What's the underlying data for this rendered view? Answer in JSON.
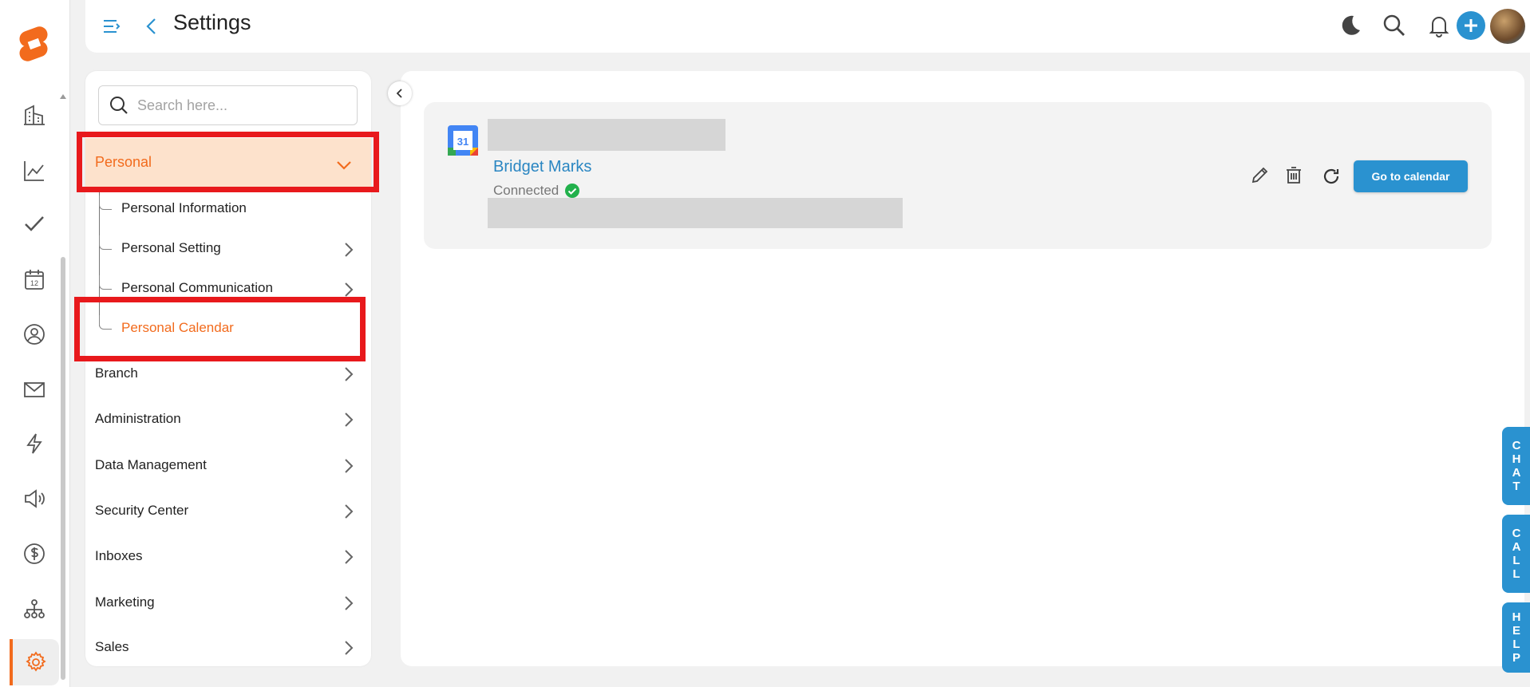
{
  "header": {
    "title": "Settings"
  },
  "search": {
    "placeholder": "Search here..."
  },
  "sidebar": {
    "groups": [
      {
        "label": "Personal",
        "expanded": true
      },
      {
        "label": "Branch"
      },
      {
        "label": "Administration"
      },
      {
        "label": "Data Management"
      },
      {
        "label": "Security Center"
      },
      {
        "label": "Inboxes"
      },
      {
        "label": "Marketing"
      },
      {
        "label": "Sales"
      }
    ],
    "personal_items": [
      {
        "label": "Personal Information"
      },
      {
        "label": "Personal Setting"
      },
      {
        "label": "Personal Communication"
      },
      {
        "label": "Personal Calendar",
        "active": true
      }
    ]
  },
  "calendar": {
    "icon_text": "31",
    "account_name": "Bridget Marks",
    "status": "Connected",
    "goto_label": "Go to calendar"
  },
  "side_tabs": {
    "chat": [
      "C",
      "H",
      "A",
      "T"
    ],
    "call": [
      "C",
      "A",
      "L",
      "L"
    ],
    "help": [
      "H",
      "E",
      "L",
      "P"
    ]
  },
  "colors": {
    "accent": "#f26b1d",
    "primary": "#2a92d0",
    "highlight_box": "#e8191c",
    "active_bg": "#fde2cc"
  },
  "icons": {
    "rail": [
      "building-icon",
      "chart-line-icon",
      "check-icon",
      "calendar-icon",
      "user-circle-icon",
      "mail-icon",
      "bolt-icon",
      "megaphone-icon",
      "dollar-icon",
      "hierarchy-icon",
      "gear-icon"
    ],
    "top": [
      "moon-icon",
      "search-icon",
      "bell-icon",
      "plus-icon",
      "avatar"
    ]
  }
}
